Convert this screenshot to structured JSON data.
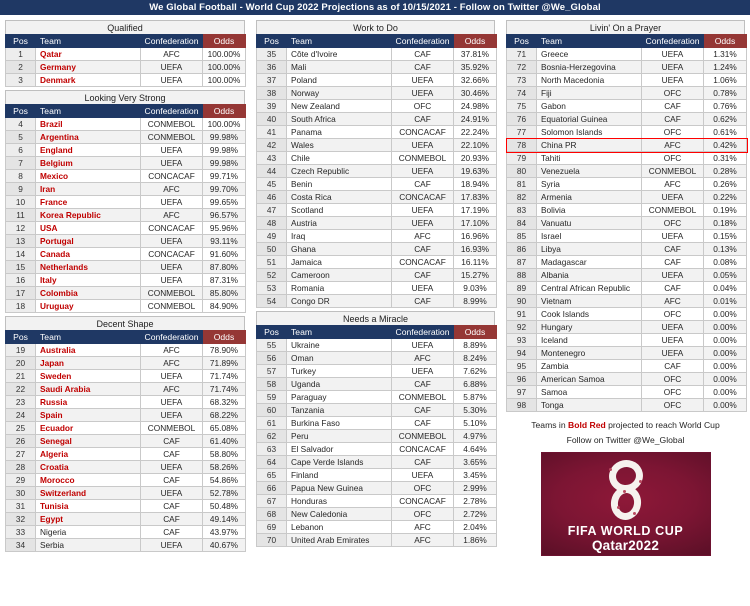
{
  "header": {
    "title": "We Global Football - World Cup 2022 Projections as of 10/15/2021 - Follow on Twitter @We_Global"
  },
  "columns_headers": {
    "pos": "Pos",
    "team": "Team",
    "confederation": "Confederation",
    "odds": "Odds"
  },
  "colors": {
    "header_navy": "#1F3864",
    "odds_maroon": "#953735",
    "qualified_red": "#C00000",
    "highlight_red": "#FF0000",
    "logo_maroon": "#7C1533"
  },
  "sections": [
    {
      "id": "qualified",
      "title": "Qualified",
      "column": 1,
      "rows": [
        {
          "pos": "1",
          "team": "Qatar",
          "conf": "AFC",
          "odds": "100.00%",
          "qualified": true
        },
        {
          "pos": "2",
          "team": "Germany",
          "conf": "UEFA",
          "odds": "100.00%",
          "qualified": true
        },
        {
          "pos": "3",
          "team": "Denmark",
          "conf": "UEFA",
          "odds": "100.00%",
          "qualified": true
        }
      ]
    },
    {
      "id": "looking-very-strong",
      "title": "Looking Very Strong",
      "column": 1,
      "rows": [
        {
          "pos": "4",
          "team": "Brazil",
          "conf": "CONMEBOL",
          "odds": "100.00%",
          "qualified": true
        },
        {
          "pos": "5",
          "team": "Argentina",
          "conf": "CONMEBOL",
          "odds": "99.98%",
          "qualified": true
        },
        {
          "pos": "6",
          "team": "England",
          "conf": "UEFA",
          "odds": "99.98%",
          "qualified": true
        },
        {
          "pos": "7",
          "team": "Belgium",
          "conf": "UEFA",
          "odds": "99.98%",
          "qualified": true
        },
        {
          "pos": "8",
          "team": "Mexico",
          "conf": "CONCACAF",
          "odds": "99.71%",
          "qualified": true
        },
        {
          "pos": "9",
          "team": "Iran",
          "conf": "AFC",
          "odds": "99.70%",
          "qualified": true
        },
        {
          "pos": "10",
          "team": "France",
          "conf": "UEFA",
          "odds": "99.65%",
          "qualified": true
        },
        {
          "pos": "11",
          "team": "Korea Republic",
          "conf": "AFC",
          "odds": "96.57%",
          "qualified": true
        },
        {
          "pos": "12",
          "team": "USA",
          "conf": "CONCACAF",
          "odds": "95.96%",
          "qualified": true
        },
        {
          "pos": "13",
          "team": "Portugal",
          "conf": "UEFA",
          "odds": "93.11%",
          "qualified": true
        },
        {
          "pos": "14",
          "team": "Canada",
          "conf": "CONCACAF",
          "odds": "91.60%",
          "qualified": true
        },
        {
          "pos": "15",
          "team": "Netherlands",
          "conf": "UEFA",
          "odds": "87.80%",
          "qualified": true
        },
        {
          "pos": "16",
          "team": "Italy",
          "conf": "UEFA",
          "odds": "87.31%",
          "qualified": true
        },
        {
          "pos": "17",
          "team": "Colombia",
          "conf": "CONMEBOL",
          "odds": "85.80%",
          "qualified": true
        },
        {
          "pos": "18",
          "team": "Uruguay",
          "conf": "CONMEBOL",
          "odds": "84.90%",
          "qualified": true
        }
      ]
    },
    {
      "id": "decent-shape",
      "title": "Decent Shape",
      "column": 1,
      "rows": [
        {
          "pos": "19",
          "team": "Australia",
          "conf": "AFC",
          "odds": "78.90%",
          "qualified": true
        },
        {
          "pos": "20",
          "team": "Japan",
          "conf": "AFC",
          "odds": "71.89%",
          "qualified": true
        },
        {
          "pos": "21",
          "team": "Sweden",
          "conf": "UEFA",
          "odds": "71.74%",
          "qualified": true
        },
        {
          "pos": "22",
          "team": "Saudi Arabia",
          "conf": "AFC",
          "odds": "71.74%",
          "qualified": true
        },
        {
          "pos": "23",
          "team": "Russia",
          "conf": "UEFA",
          "odds": "68.32%",
          "qualified": true
        },
        {
          "pos": "24",
          "team": "Spain",
          "conf": "UEFA",
          "odds": "68.22%",
          "qualified": true
        },
        {
          "pos": "25",
          "team": "Ecuador",
          "conf": "CONMEBOL",
          "odds": "65.08%",
          "qualified": true
        },
        {
          "pos": "26",
          "team": "Senegal",
          "conf": "CAF",
          "odds": "61.40%",
          "qualified": true
        },
        {
          "pos": "27",
          "team": "Algeria",
          "conf": "CAF",
          "odds": "58.80%",
          "qualified": true
        },
        {
          "pos": "28",
          "team": "Croatia",
          "conf": "UEFA",
          "odds": "58.26%",
          "qualified": true
        },
        {
          "pos": "29",
          "team": "Morocco",
          "conf": "CAF",
          "odds": "54.86%",
          "qualified": true
        },
        {
          "pos": "30",
          "team": "Switzerland",
          "conf": "UEFA",
          "odds": "52.78%",
          "qualified": true
        },
        {
          "pos": "31",
          "team": "Tunisia",
          "conf": "CAF",
          "odds": "50.48%",
          "qualified": true
        },
        {
          "pos": "32",
          "team": "Egypt",
          "conf": "CAF",
          "odds": "49.14%",
          "qualified": true
        },
        {
          "pos": "33",
          "team": "Nigeria",
          "conf": "CAF",
          "odds": "43.97%",
          "qualified": false
        },
        {
          "pos": "34",
          "team": "Serbia",
          "conf": "UEFA",
          "odds": "40.67%",
          "qualified": false
        }
      ]
    },
    {
      "id": "work-to-do",
      "title": "Work to Do",
      "column": 2,
      "rows": [
        {
          "pos": "35",
          "team": "Côte d'Ivoire",
          "conf": "CAF",
          "odds": "37.81%",
          "qualified": false
        },
        {
          "pos": "36",
          "team": "Mali",
          "conf": "CAF",
          "odds": "35.92%",
          "qualified": false
        },
        {
          "pos": "37",
          "team": "Poland",
          "conf": "UEFA",
          "odds": "32.66%",
          "qualified": false
        },
        {
          "pos": "38",
          "team": "Norway",
          "conf": "UEFA",
          "odds": "30.46%",
          "qualified": false
        },
        {
          "pos": "39",
          "team": "New Zealand",
          "conf": "OFC",
          "odds": "24.98%",
          "qualified": false
        },
        {
          "pos": "40",
          "team": "South Africa",
          "conf": "CAF",
          "odds": "24.91%",
          "qualified": false
        },
        {
          "pos": "41",
          "team": "Panama",
          "conf": "CONCACAF",
          "odds": "22.24%",
          "qualified": false
        },
        {
          "pos": "42",
          "team": "Wales",
          "conf": "UEFA",
          "odds": "22.10%",
          "qualified": false
        },
        {
          "pos": "43",
          "team": "Chile",
          "conf": "CONMEBOL",
          "odds": "20.93%",
          "qualified": false
        },
        {
          "pos": "44",
          "team": "Czech Republic",
          "conf": "UEFA",
          "odds": "19.63%",
          "qualified": false
        },
        {
          "pos": "45",
          "team": "Benin",
          "conf": "CAF",
          "odds": "18.94%",
          "qualified": false
        },
        {
          "pos": "46",
          "team": "Costa Rica",
          "conf": "CONCACAF",
          "odds": "17.83%",
          "qualified": false
        },
        {
          "pos": "47",
          "team": "Scotland",
          "conf": "UEFA",
          "odds": "17.19%",
          "qualified": false
        },
        {
          "pos": "48",
          "team": "Austria",
          "conf": "UEFA",
          "odds": "17.10%",
          "qualified": false
        },
        {
          "pos": "49",
          "team": "Iraq",
          "conf": "AFC",
          "odds": "16.96%",
          "qualified": false
        },
        {
          "pos": "50",
          "team": "Ghana",
          "conf": "CAF",
          "odds": "16.93%",
          "qualified": false
        },
        {
          "pos": "51",
          "team": "Jamaica",
          "conf": "CONCACAF",
          "odds": "16.11%",
          "qualified": false
        },
        {
          "pos": "52",
          "team": "Cameroon",
          "conf": "CAF",
          "odds": "15.27%",
          "qualified": false
        },
        {
          "pos": "53",
          "team": "Romania",
          "conf": "UEFA",
          "odds": "9.03%",
          "qualified": false
        },
        {
          "pos": "54",
          "team": "Congo DR",
          "conf": "CAF",
          "odds": "8.99%",
          "qualified": false
        }
      ]
    },
    {
      "id": "needs-a-miracle",
      "title": "Needs a Miracle",
      "column": 2,
      "rows": [
        {
          "pos": "55",
          "team": "Ukraine",
          "conf": "UEFA",
          "odds": "8.89%",
          "qualified": false
        },
        {
          "pos": "56",
          "team": "Oman",
          "conf": "AFC",
          "odds": "8.24%",
          "qualified": false
        },
        {
          "pos": "57",
          "team": "Turkey",
          "conf": "UEFA",
          "odds": "7.62%",
          "qualified": false
        },
        {
          "pos": "58",
          "team": "Uganda",
          "conf": "CAF",
          "odds": "6.88%",
          "qualified": false
        },
        {
          "pos": "59",
          "team": "Paraguay",
          "conf": "CONMEBOL",
          "odds": "5.87%",
          "qualified": false
        },
        {
          "pos": "60",
          "team": "Tanzania",
          "conf": "CAF",
          "odds": "5.30%",
          "qualified": false
        },
        {
          "pos": "61",
          "team": "Burkina Faso",
          "conf": "CAF",
          "odds": "5.10%",
          "qualified": false
        },
        {
          "pos": "62",
          "team": "Peru",
          "conf": "CONMEBOL",
          "odds": "4.97%",
          "qualified": false
        },
        {
          "pos": "63",
          "team": "El Salvador",
          "conf": "CONCACAF",
          "odds": "4.64%",
          "qualified": false
        },
        {
          "pos": "64",
          "team": "Cape Verde Islands",
          "conf": "CAF",
          "odds": "3.65%",
          "qualified": false
        },
        {
          "pos": "65",
          "team": "Finland",
          "conf": "UEFA",
          "odds": "3.45%",
          "qualified": false
        },
        {
          "pos": "66",
          "team": "Papua New Guinea",
          "conf": "OFC",
          "odds": "2.99%",
          "qualified": false
        },
        {
          "pos": "67",
          "team": "Honduras",
          "conf": "CONCACAF",
          "odds": "2.78%",
          "qualified": false
        },
        {
          "pos": "68",
          "team": "New Caledonia",
          "conf": "OFC",
          "odds": "2.72%",
          "qualified": false
        },
        {
          "pos": "69",
          "team": "Lebanon",
          "conf": "AFC",
          "odds": "2.04%",
          "qualified": false
        },
        {
          "pos": "70",
          "team": "United Arab Emirates",
          "conf": "AFC",
          "odds": "1.86%",
          "qualified": false
        }
      ]
    },
    {
      "id": "livin-on-a-prayer",
      "title": "Livin' On a Prayer",
      "column": 3,
      "rows": [
        {
          "pos": "71",
          "team": "Greece",
          "conf": "UEFA",
          "odds": "1.31%",
          "qualified": false
        },
        {
          "pos": "72",
          "team": "Bosnia-Herzegovina",
          "conf": "UEFA",
          "odds": "1.24%",
          "qualified": false
        },
        {
          "pos": "73",
          "team": "North Macedonia",
          "conf": "UEFA",
          "odds": "1.06%",
          "qualified": false
        },
        {
          "pos": "74",
          "team": "Fiji",
          "conf": "OFC",
          "odds": "0.78%",
          "qualified": false
        },
        {
          "pos": "75",
          "team": "Gabon",
          "conf": "CAF",
          "odds": "0.76%",
          "qualified": false
        },
        {
          "pos": "76",
          "team": "Equatorial Guinea",
          "conf": "CAF",
          "odds": "0.62%",
          "qualified": false
        },
        {
          "pos": "77",
          "team": "Solomon Islands",
          "conf": "OFC",
          "odds": "0.61%",
          "qualified": false
        },
        {
          "pos": "78",
          "team": "China PR",
          "conf": "AFC",
          "odds": "0.42%",
          "qualified": false,
          "highlighted": true
        },
        {
          "pos": "79",
          "team": "Tahiti",
          "conf": "OFC",
          "odds": "0.31%",
          "qualified": false
        },
        {
          "pos": "80",
          "team": "Venezuela",
          "conf": "CONMEBOL",
          "odds": "0.28%",
          "qualified": false
        },
        {
          "pos": "81",
          "team": "Syria",
          "conf": "AFC",
          "odds": "0.26%",
          "qualified": false
        },
        {
          "pos": "82",
          "team": "Armenia",
          "conf": "UEFA",
          "odds": "0.22%",
          "qualified": false
        },
        {
          "pos": "83",
          "team": "Bolivia",
          "conf": "CONMEBOL",
          "odds": "0.19%",
          "qualified": false
        },
        {
          "pos": "84",
          "team": "Vanuatu",
          "conf": "OFC",
          "odds": "0.18%",
          "qualified": false
        },
        {
          "pos": "85",
          "team": "Israel",
          "conf": "UEFA",
          "odds": "0.15%",
          "qualified": false
        },
        {
          "pos": "86",
          "team": "Libya",
          "conf": "CAF",
          "odds": "0.13%",
          "qualified": false
        },
        {
          "pos": "87",
          "team": "Madagascar",
          "conf": "CAF",
          "odds": "0.08%",
          "qualified": false
        },
        {
          "pos": "88",
          "team": "Albania",
          "conf": "UEFA",
          "odds": "0.05%",
          "qualified": false
        },
        {
          "pos": "89",
          "team": "Central African Republic",
          "conf": "CAF",
          "odds": "0.04%",
          "qualified": false
        },
        {
          "pos": "90",
          "team": "Vietnam",
          "conf": "AFC",
          "odds": "0.01%",
          "qualified": false
        },
        {
          "pos": "91",
          "team": "Cook Islands",
          "conf": "OFC",
          "odds": "0.00%",
          "qualified": false
        },
        {
          "pos": "92",
          "team": "Hungary",
          "conf": "UEFA",
          "odds": "0.00%",
          "qualified": false
        },
        {
          "pos": "93",
          "team": "Iceland",
          "conf": "UEFA",
          "odds": "0.00%",
          "qualified": false
        },
        {
          "pos": "94",
          "team": "Montenegro",
          "conf": "UEFA",
          "odds": "0.00%",
          "qualified": false
        },
        {
          "pos": "95",
          "team": "Zambia",
          "conf": "CAF",
          "odds": "0.00%",
          "qualified": false
        },
        {
          "pos": "96",
          "team": "American Samoa",
          "conf": "OFC",
          "odds": "0.00%",
          "qualified": false
        },
        {
          "pos": "97",
          "team": "Samoa",
          "conf": "OFC",
          "odds": "0.00%",
          "qualified": false
        },
        {
          "pos": "98",
          "team": "Tonga",
          "conf": "OFC",
          "odds": "0.00%",
          "qualified": false
        }
      ]
    }
  ],
  "footer": {
    "legend_pre": "Teams in ",
    "legend_emphasis": "Bold Red",
    "legend_post": " projected to reach World Cup",
    "twitter": "Follow on Twitter @We_Global"
  },
  "logo": {
    "line1": "FIFA WORLD CUP",
    "line2": "Qatar2022"
  }
}
